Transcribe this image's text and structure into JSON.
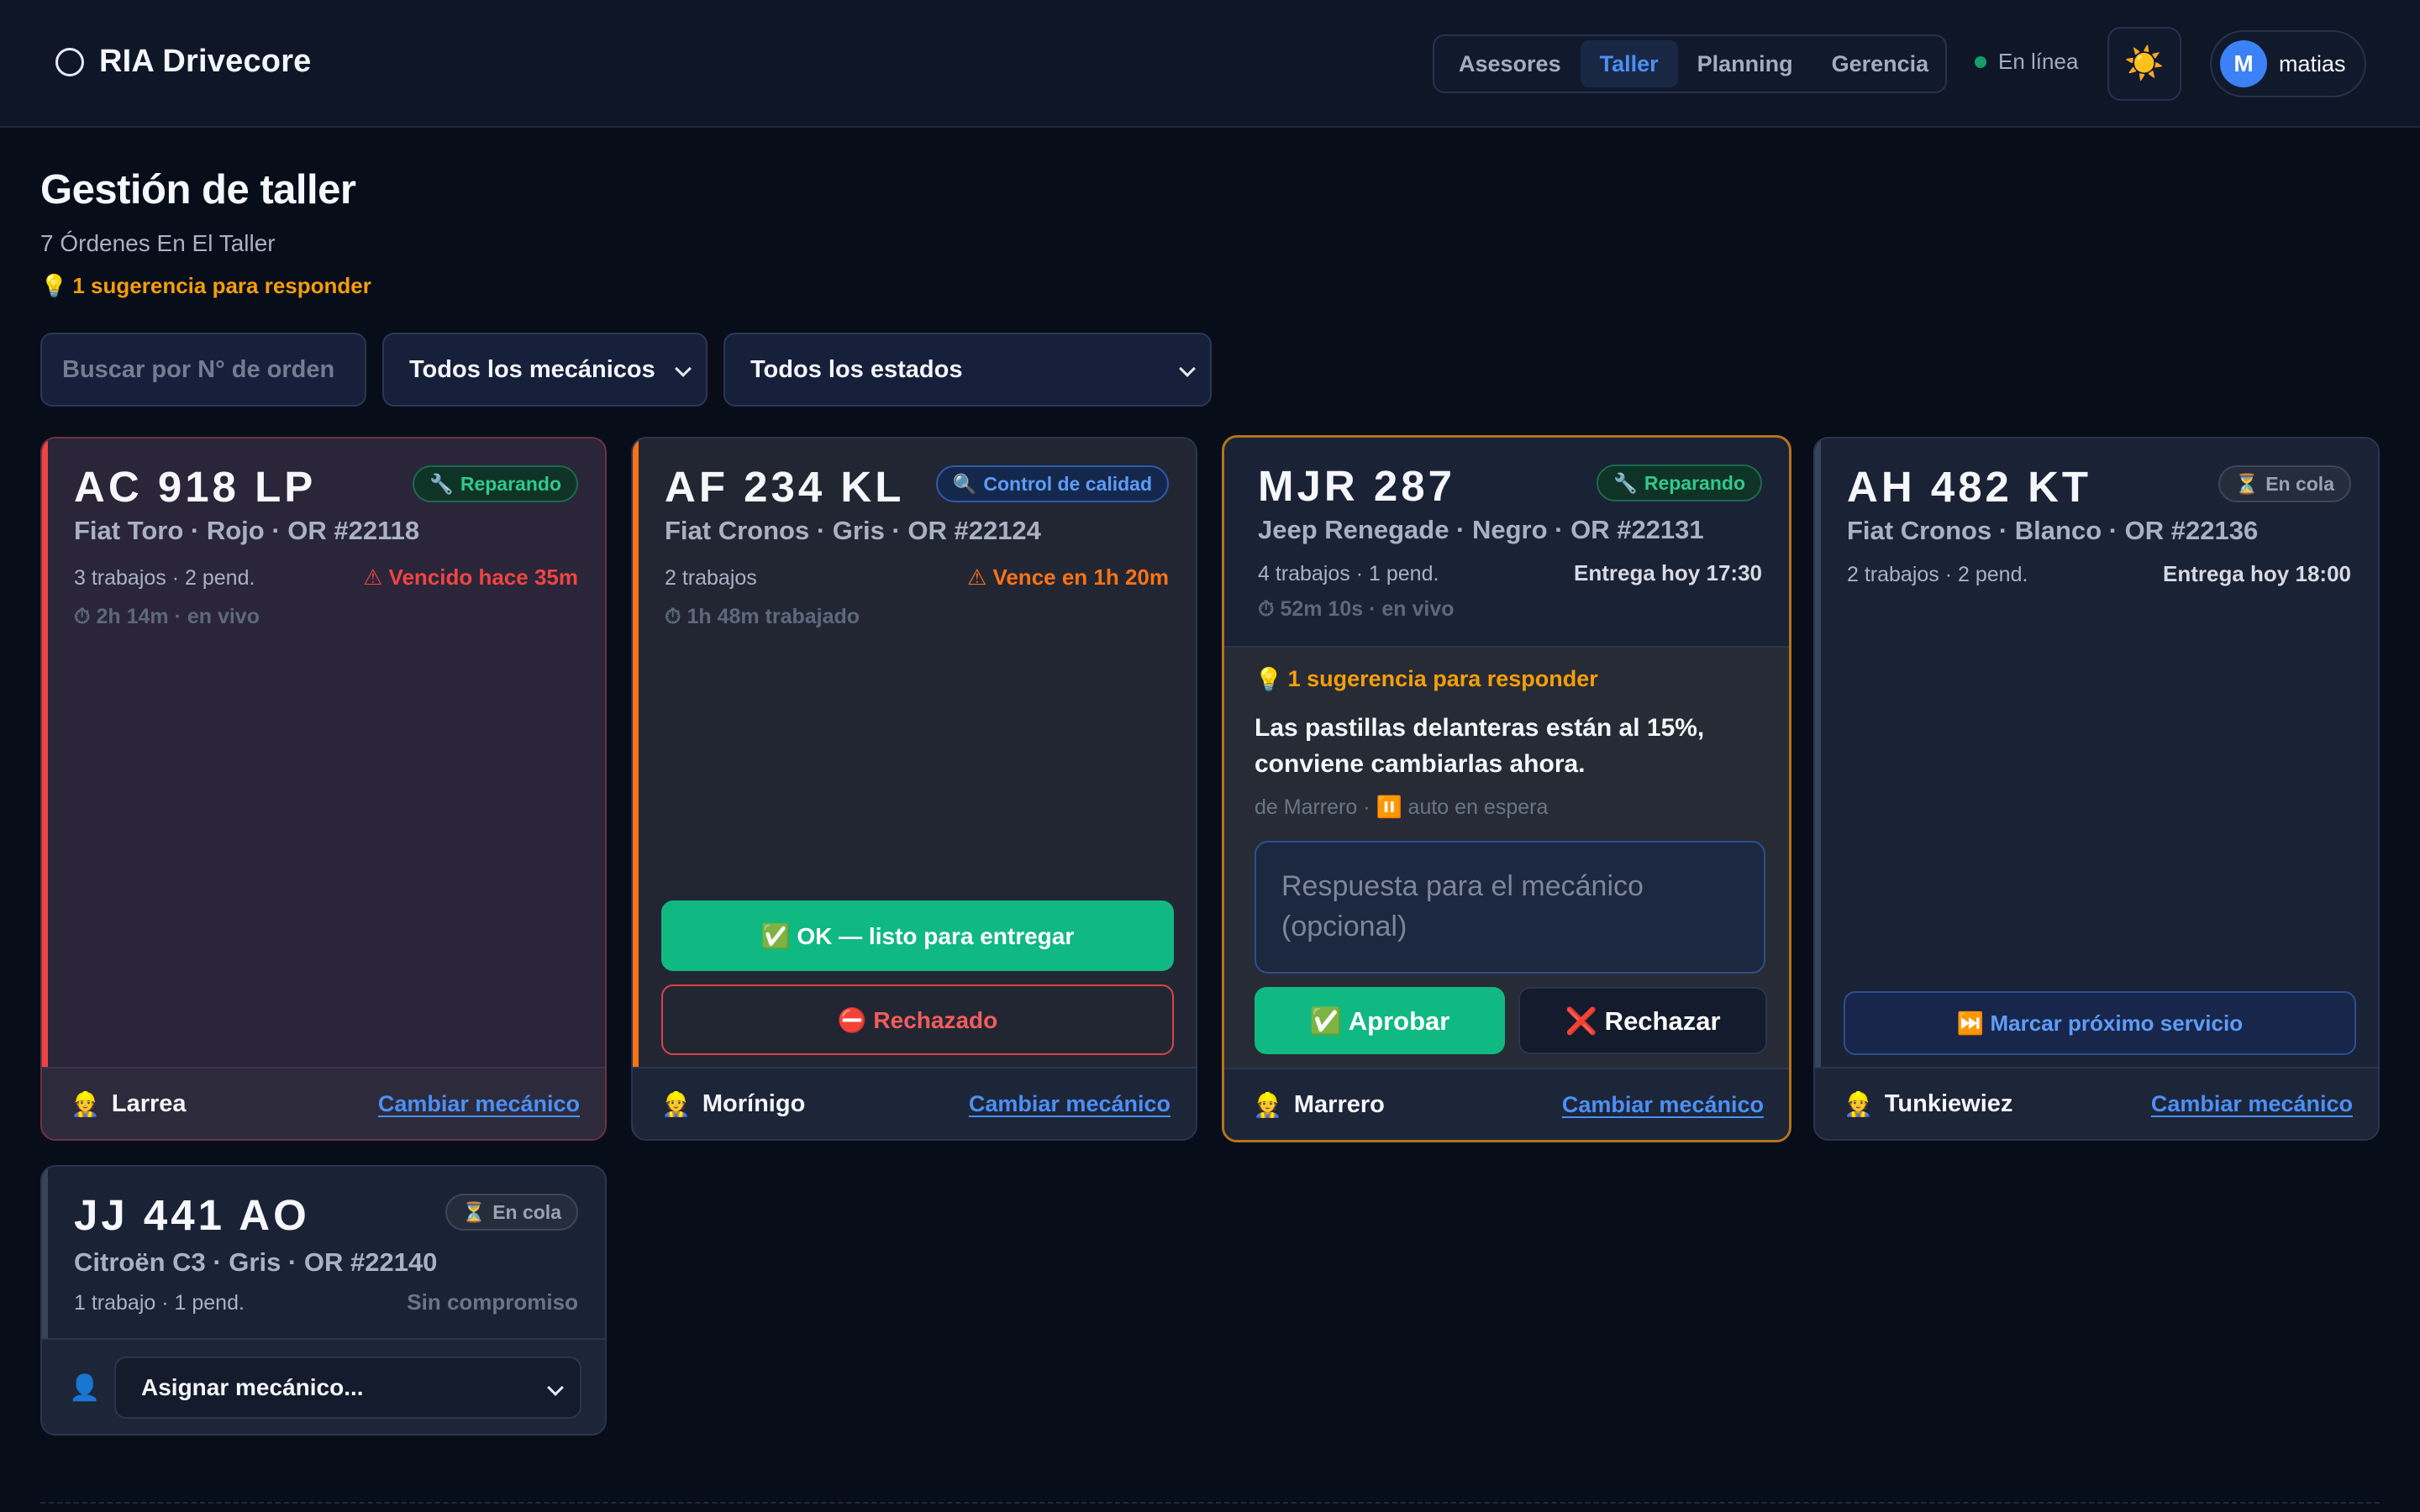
{
  "header": {
    "brand": "RIA Drivecore",
    "tabs": [
      {
        "label": "Asesores",
        "active": false
      },
      {
        "label": "Taller",
        "active": true
      },
      {
        "label": "Planning",
        "active": false
      },
      {
        "label": "Gerencia",
        "active": false
      }
    ],
    "status": "En línea",
    "theme_icon": "sun-icon",
    "user": {
      "initial": "M",
      "name": "matias"
    }
  },
  "page": {
    "title": "Gestión de taller",
    "subtitle": "7 Órdenes En El Taller",
    "suggestions": "1 sugerencia para responder"
  },
  "filters": {
    "search_placeholder": "Buscar por N° de orden",
    "mechanic": "Todos los mecánicos",
    "status": "Todos los estados"
  },
  "cards": [
    {
      "plate": "AC 918 LP",
      "model": "Fiat Toro · Rojo · OR #22118",
      "badge": "Reparando",
      "badge_icon": "wrench-icon",
      "jobs": "3 trabajos · 2 pend.",
      "due": "⚠ Vencido hace 35m",
      "timer": "⏱ 2h 14m · en vivo",
      "mechanic": "Larrea",
      "change": "Cambiar mecánico"
    },
    {
      "plate": "AF 234 KL",
      "model": "Fiat Cronos · Gris · OR #22124",
      "badge": "Control de calidad",
      "badge_icon": "magnifier-icon",
      "jobs": "2 trabajos",
      "due": "⚠ Vence en 1h 20m",
      "timer": "⏱ 1h 48m trabajado",
      "ok_button": "✅ OK — listo para entregar",
      "reject_button": "⛔ Rechazado",
      "mechanic": "Morínigo",
      "change": "Cambiar mecánico"
    },
    {
      "plate": "MJR 287",
      "model": "Jeep Renegade · Negro · OR #22131",
      "badge": "Reparando",
      "badge_icon": "wrench-icon",
      "jobs": "4 trabajos · 1 pend.",
      "due": "Entrega hoy 17:30",
      "timer": "⏱ 52m 10s · en vivo",
      "suggestion": {
        "title": "1 sugerencia para responder",
        "text": "Las pastillas delanteras están al 15%, conviene cambiarlas ahora.",
        "meta": "de Marrero · ⏸️ auto en espera",
        "reply_placeholder": "Respuesta para el mecánico (opcional)",
        "approve": "✅ Aprobar",
        "reject": "❌ Rechazar"
      },
      "mechanic": "Marrero",
      "change": "Cambiar mecánico"
    },
    {
      "plate": "AH 482 KT",
      "model": "Fiat Cronos · Blanco · OR #22136",
      "badge": "En cola",
      "badge_icon": "hourglass-icon",
      "jobs": "2 trabajos · 2 pend.",
      "due": "Entrega hoy 18:00",
      "next_service": "⏭️ Marcar próximo servicio",
      "mechanic": "Tunkiewiez",
      "change": "Cambiar mecánico"
    },
    {
      "plate": "JJ 441 AO",
      "model": "Citroën C3 · Gris · OR #22140",
      "badge": "En cola",
      "badge_icon": "hourglass-icon",
      "jobs": "1 trabajo · 1 pend.",
      "due": "Sin compromiso",
      "assign": "Asignar mecánico..."
    }
  ],
  "colors": {
    "background": "#080d1a",
    "accent_blue": "#4c8ff5",
    "green": "#10b981",
    "orange": "#f97316",
    "red": "#ef4444",
    "amber": "#f59e0b"
  }
}
